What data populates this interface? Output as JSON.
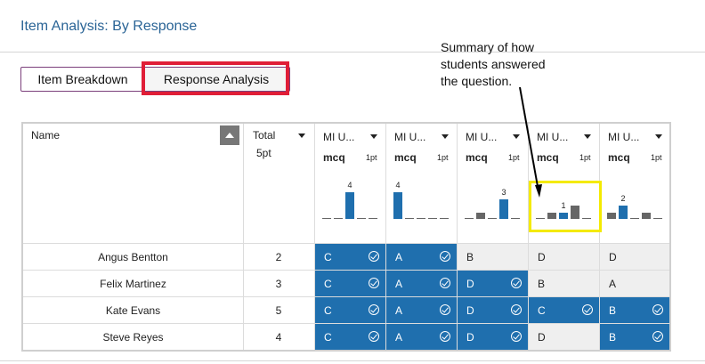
{
  "page": {
    "title": "Item Analysis: By Response"
  },
  "tabs": [
    {
      "label": "Item Breakdown",
      "active": false
    },
    {
      "label": "Response Analysis",
      "active": true
    }
  ],
  "annotation": {
    "lines": [
      "Summary of how",
      "students answered",
      "the question."
    ],
    "highlight_color": "#e01e37",
    "callout_color": "#f4ea00"
  },
  "table": {
    "name_header": "Name",
    "total_header": "Total",
    "total_sub": "5pt",
    "questions": [
      {
        "title": "MI U...",
        "type": "mcq",
        "points": "1pt",
        "bars": [
          0,
          0,
          4,
          0,
          0
        ],
        "highlight": 2,
        "label": "4"
      },
      {
        "title": "MI U...",
        "type": "mcq",
        "points": "1pt",
        "bars": [
          4,
          0,
          0,
          0,
          0
        ],
        "highlight": 0,
        "label": "4"
      },
      {
        "title": "MI U...",
        "type": "mcq",
        "points": "1pt",
        "bars": [
          0,
          1,
          0,
          3,
          0
        ],
        "highlight": 3,
        "label": "3"
      },
      {
        "title": "MI U...",
        "type": "mcq",
        "points": "1pt",
        "bars": [
          0,
          1,
          1,
          2,
          0
        ],
        "highlight": 2,
        "label": "1"
      },
      {
        "title": "MI U...",
        "type": "mcq",
        "points": "1pt",
        "bars": [
          1,
          2,
          0,
          1,
          0
        ],
        "highlight": 1,
        "label": "2"
      }
    ],
    "students": [
      {
        "name": "Angus Bentton",
        "total": "2",
        "responses": [
          {
            "v": "C",
            "c": true
          },
          {
            "v": "A",
            "c": true
          },
          {
            "v": "B",
            "c": false
          },
          {
            "v": "D",
            "c": false
          },
          {
            "v": "D",
            "c": false
          }
        ]
      },
      {
        "name": "Felix Martinez",
        "total": "3",
        "responses": [
          {
            "v": "C",
            "c": true
          },
          {
            "v": "A",
            "c": true
          },
          {
            "v": "D",
            "c": true
          },
          {
            "v": "B",
            "c": false
          },
          {
            "v": "A",
            "c": false
          }
        ]
      },
      {
        "name": "Kate Evans",
        "total": "5",
        "responses": [
          {
            "v": "C",
            "c": true
          },
          {
            "v": "A",
            "c": true
          },
          {
            "v": "D",
            "c": true
          },
          {
            "v": "C",
            "c": true
          },
          {
            "v": "B",
            "c": true
          }
        ]
      },
      {
        "name": "Steve Reyes",
        "total": "4",
        "responses": [
          {
            "v": "C",
            "c": true
          },
          {
            "v": "A",
            "c": true
          },
          {
            "v": "D",
            "c": true
          },
          {
            "v": "D",
            "c": false
          },
          {
            "v": "B",
            "c": true
          }
        ]
      }
    ]
  },
  "colors": {
    "correct": "#1f6fae",
    "wrong": "#efefef",
    "bar_gray": "#666666",
    "bar_blue": "#1f6fae",
    "title": "#2a6496"
  }
}
